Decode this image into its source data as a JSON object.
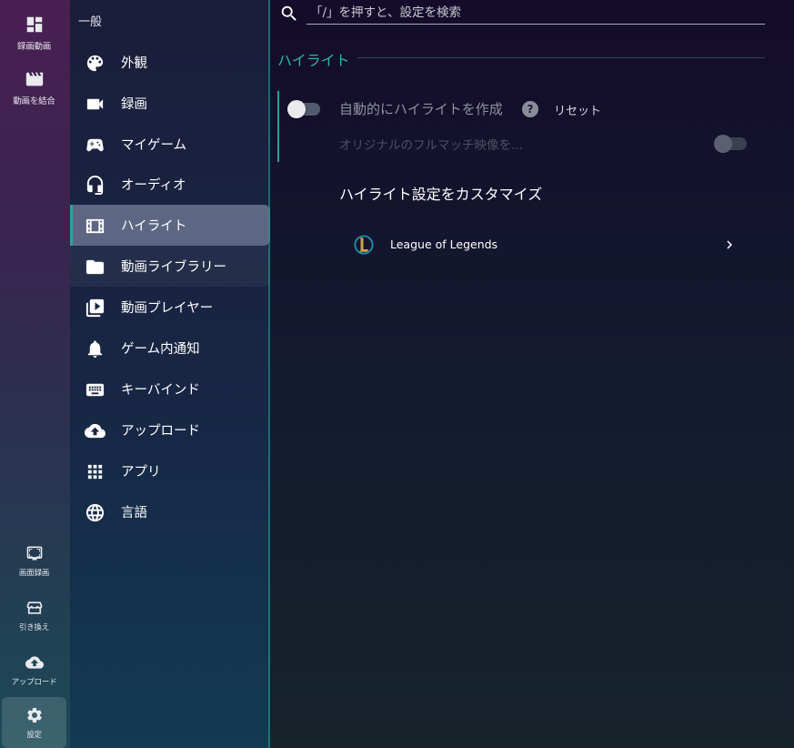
{
  "rail": {
    "top_items": [
      {
        "label": "録画動画",
        "icon": "dashboard-icon"
      },
      {
        "label": "動画を結合",
        "icon": "clapperboard-icon"
      }
    ],
    "bottom_items": [
      {
        "label": "画面録画",
        "icon": "screen-capture-icon"
      },
      {
        "label": "引き換え",
        "icon": "store-icon"
      },
      {
        "label": "アップロード",
        "icon": "cloud-upload-icon"
      },
      {
        "label": "設定",
        "icon": "gear-icon"
      }
    ]
  },
  "sidebar": {
    "title": "一般",
    "items": [
      {
        "label": "外観",
        "icon": "palette-icon"
      },
      {
        "label": "録画",
        "icon": "video-camera-icon"
      },
      {
        "label": "マイゲーム",
        "icon": "gamepad-icon"
      },
      {
        "label": "オーディオ",
        "icon": "headphones-icon"
      },
      {
        "label": "ハイライト",
        "icon": "film-icon",
        "active": true
      },
      {
        "label": "動画ライブラリー",
        "icon": "folder-icon"
      },
      {
        "label": "動画プレイヤー",
        "icon": "video-library-icon"
      },
      {
        "label": "ゲーム内通知",
        "icon": "bell-icon"
      },
      {
        "label": "キーバインド",
        "icon": "keyboard-icon"
      },
      {
        "label": "アップロード",
        "icon": "cloud-upload-icon"
      },
      {
        "label": "アプリ",
        "icon": "apps-grid-icon"
      },
      {
        "label": "言語",
        "icon": "globe-icon"
      }
    ]
  },
  "search": {
    "placeholder": "「/」を押すと、設定を検索",
    "value": ""
  },
  "highlight": {
    "section_title": "ハイライト",
    "auto_create_label": "自動的にハイライトを作成",
    "reset_label": "リセット",
    "original_full_match_label": "オリジナルのフルマッチ映像を...",
    "auto_create_enabled": false,
    "original_full_match_enabled": false,
    "customize_title": "ハイライト設定をカスタマイズ",
    "games": [
      {
        "name": "League of Legends",
        "icon": "league-of-legends-logo"
      }
    ]
  },
  "colors": {
    "accent": "#2bb3a6"
  }
}
